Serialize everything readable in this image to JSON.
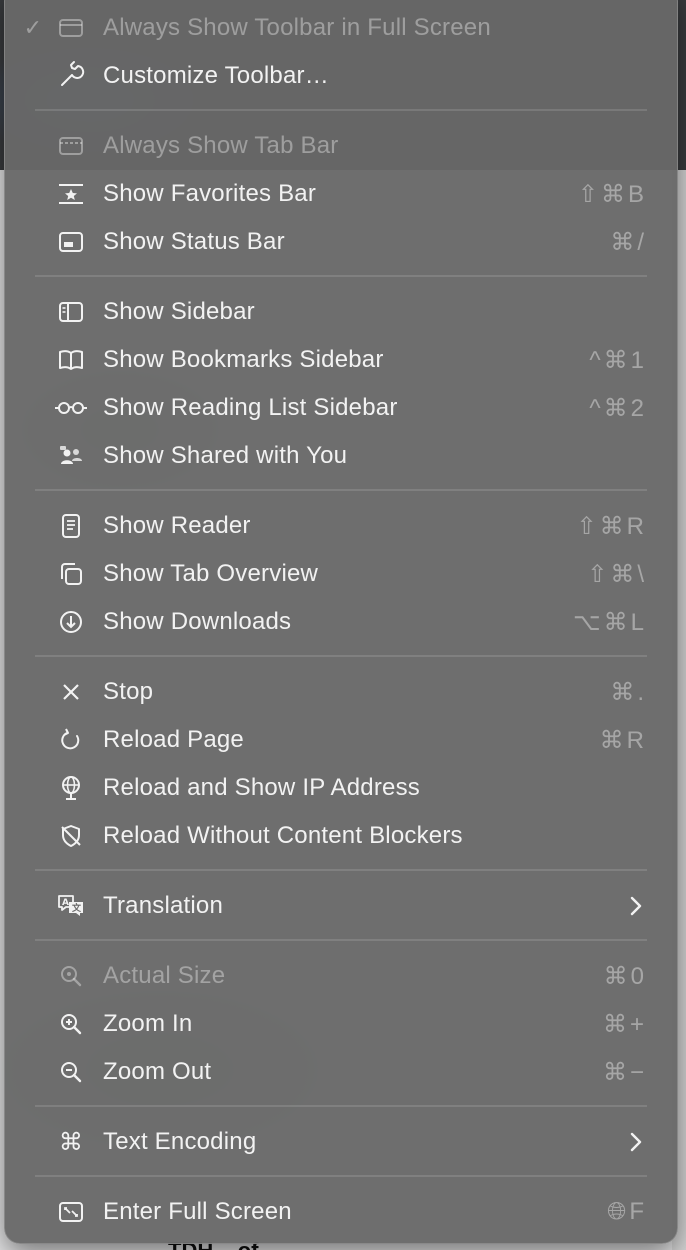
{
  "background": {
    "partial_heading": "TDH... of"
  },
  "menu": {
    "items": [
      {
        "id": "always-show-toolbar",
        "label": "Always Show Toolbar in Full Screen",
        "checked": true,
        "disabled": true,
        "icon": "toolbar-icon",
        "shortcut": ""
      },
      {
        "id": "customize-toolbar",
        "label": "Customize Toolbar…",
        "icon": "wrench-icon",
        "shortcut": ""
      },
      {
        "id": "always-show-tab-bar",
        "label": "Always Show Tab Bar",
        "disabled": true,
        "icon": "tab-bar-icon",
        "shortcut": ""
      },
      {
        "id": "show-favorites-bar",
        "label": "Show Favorites Bar",
        "icon": "favorites-bar-icon",
        "shortcut": "⇧⌘B"
      },
      {
        "id": "show-status-bar",
        "label": "Show Status Bar",
        "icon": "status-bar-icon",
        "shortcut": "⌘/"
      },
      {
        "id": "show-sidebar",
        "label": "Show Sidebar",
        "icon": "sidebar-icon",
        "shortcut": ""
      },
      {
        "id": "show-bookmarks-sidebar",
        "label": "Show Bookmarks Sidebar",
        "icon": "book-icon",
        "shortcut": "^⌘1"
      },
      {
        "id": "show-reading-list-sidebar",
        "label": "Show Reading List Sidebar",
        "icon": "glasses-icon",
        "shortcut": "^⌘2"
      },
      {
        "id": "show-shared-with-you",
        "label": "Show Shared with You",
        "icon": "shared-people-icon",
        "shortcut": ""
      },
      {
        "id": "show-reader",
        "label": "Show Reader",
        "icon": "reader-icon",
        "shortcut": "⇧⌘R"
      },
      {
        "id": "show-tab-overview",
        "label": "Show Tab Overview",
        "icon": "tab-overview-icon",
        "shortcut": "⇧⌘\\"
      },
      {
        "id": "show-downloads",
        "label": "Show Downloads",
        "icon": "download-icon",
        "shortcut": "⌥⌘L"
      },
      {
        "id": "stop",
        "label": "Stop",
        "icon": "close-icon",
        "shortcut": "⌘."
      },
      {
        "id": "reload-page",
        "label": "Reload Page",
        "icon": "reload-icon",
        "shortcut": "⌘R"
      },
      {
        "id": "reload-ip",
        "label": "Reload and Show IP Address",
        "icon": "globe-pin-icon",
        "shortcut": ""
      },
      {
        "id": "reload-no-blockers",
        "label": "Reload Without Content Blockers",
        "icon": "shield-slash-icon",
        "shortcut": ""
      },
      {
        "id": "translation",
        "label": "Translation",
        "icon": "translate-icon",
        "shortcut": "",
        "submenu": true
      },
      {
        "id": "actual-size",
        "label": "Actual Size",
        "disabled": true,
        "icon": "magnifier-icon",
        "shortcut": "⌘0"
      },
      {
        "id": "zoom-in",
        "label": "Zoom In",
        "icon": "zoom-in-icon",
        "shortcut": "⌘+"
      },
      {
        "id": "zoom-out",
        "label": "Zoom Out",
        "icon": "zoom-out-icon",
        "shortcut": "⌘−"
      },
      {
        "id": "text-encoding",
        "label": "Text Encoding",
        "icon": "command-icon",
        "shortcut": "",
        "submenu": true
      },
      {
        "id": "enter-full-screen",
        "label": "Enter Full Screen",
        "icon": "full-screen-icon",
        "shortcut": "🌐︎F"
      }
    ]
  }
}
